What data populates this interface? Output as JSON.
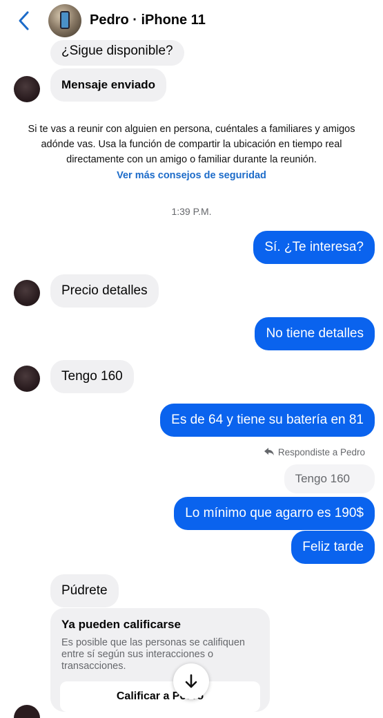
{
  "header": {
    "title": "Pedro · iPhone 11"
  },
  "messages": {
    "m1": "¿Sigue disponible?",
    "m2": "Mensaje enviado",
    "m3": "Sí. ¿Te interesa?",
    "m4": "Precio detalles",
    "m5": "No tiene detalles",
    "m6": "Tengo 160",
    "m7": "Es de 64 y tiene su batería en 81",
    "m8": "Lo mínimo que agarro es 190$",
    "m9": "Feliz tarde",
    "m10": "Púdrete"
  },
  "notice": {
    "text": "Si te vas a reunir con alguien en persona, cuéntales a familiares y amigos adónde vas. Usa la función de compartir la ubicación en tiempo real directamente con un amigo o familiar durante la reunión.",
    "link": "Ver más consejos de seguridad"
  },
  "timestamp": "1:39 P.M.",
  "reply": {
    "label": "Respondiste a Pedro",
    "quoted": "Tengo 160"
  },
  "rating_card": {
    "title": "Ya pueden calificarse",
    "body": "Es posible que las personas se califiquen entre sí según sus interacciones o transacciones.",
    "button": "Calificar a Pedro"
  },
  "colors": {
    "outgoing": "#0a63ee",
    "incoming": "#f0f0f2",
    "link": "#1c6bc9"
  },
  "icons": [
    "back-chevron-icon",
    "reply-arrow-icon",
    "arrow-down-icon"
  ]
}
